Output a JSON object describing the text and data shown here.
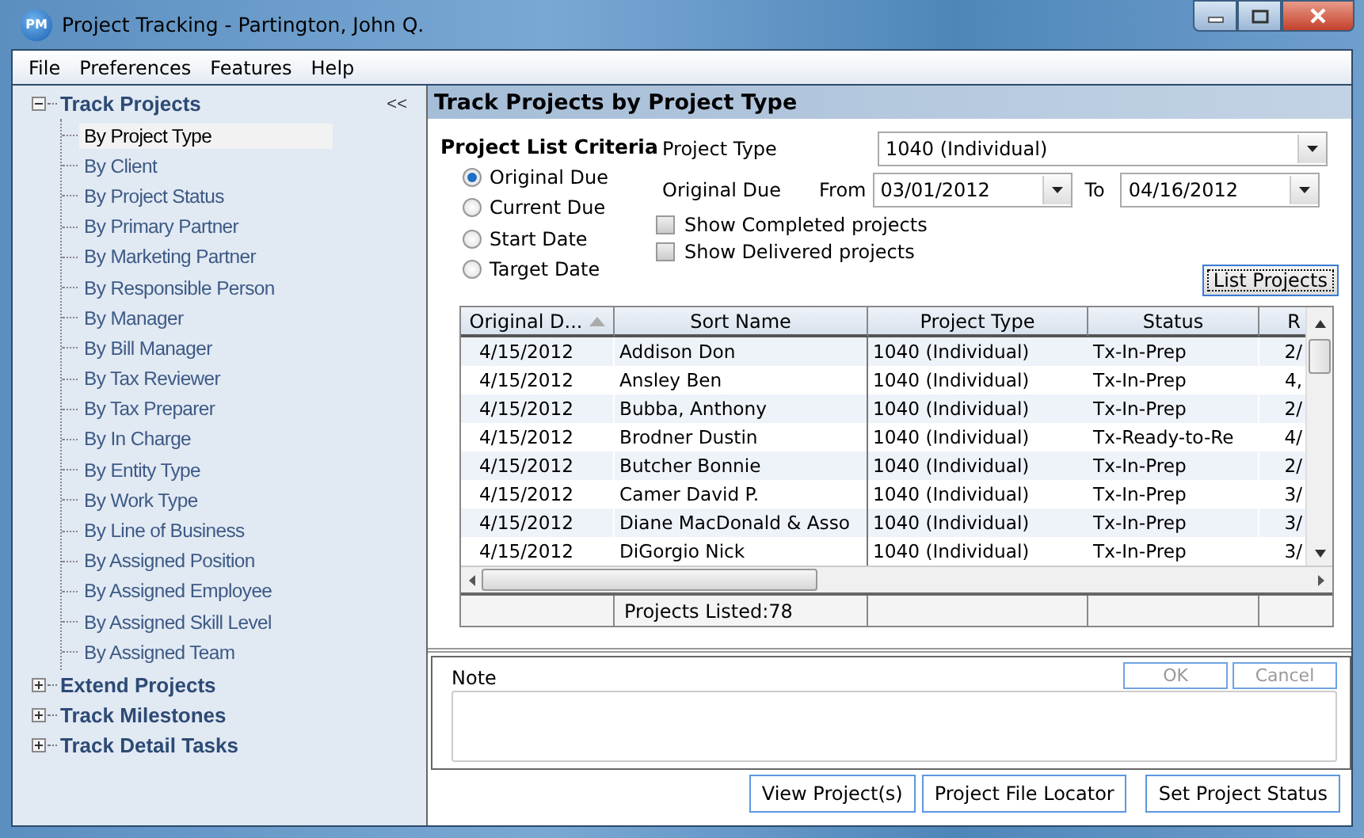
{
  "window": {
    "title": "Project Tracking - Partington, John Q.",
    "app_icon_text": "PM"
  },
  "menu": [
    "File",
    "Preferences",
    "Features",
    "Help"
  ],
  "sidebar": {
    "collapse": "<<",
    "groups": [
      {
        "label": "Track Projects",
        "expanded": true,
        "children": [
          {
            "label": "By Project Type",
            "selected": true
          },
          {
            "label": "By Client",
            "selected": false
          },
          {
            "label": "By Project Status",
            "selected": false
          },
          {
            "label": "By Primary Partner",
            "selected": false
          },
          {
            "label": "By Marketing Partner",
            "selected": false
          },
          {
            "label": "By Responsible Person",
            "selected": false
          },
          {
            "label": "By Manager",
            "selected": false
          },
          {
            "label": "By Bill Manager",
            "selected": false
          },
          {
            "label": "By Tax Reviewer",
            "selected": false
          },
          {
            "label": "By Tax Preparer",
            "selected": false
          },
          {
            "label": "By In Charge",
            "selected": false
          },
          {
            "label": "By Entity Type",
            "selected": false
          },
          {
            "label": "By Work Type",
            "selected": false
          },
          {
            "label": "By Line of Business",
            "selected": false
          },
          {
            "label": "By Assigned Position",
            "selected": false
          },
          {
            "label": "By Assigned Employee",
            "selected": false
          },
          {
            "label": "By Assigned Skill Level",
            "selected": false
          },
          {
            "label": "By Assigned Team",
            "selected": false
          }
        ]
      },
      {
        "label": "Extend Projects",
        "expanded": false
      },
      {
        "label": "Track Milestones",
        "expanded": false
      },
      {
        "label": "Track Detail Tasks",
        "expanded": false
      }
    ]
  },
  "panel": {
    "title": "Track Projects by Project Type",
    "criteria_label": "Project List Criteria",
    "date_options": [
      {
        "label": "Original Due",
        "selected": true
      },
      {
        "label": "Current Due",
        "selected": false
      },
      {
        "label": "Start Date",
        "selected": false
      },
      {
        "label": "Target Date",
        "selected": false
      }
    ],
    "project_type": {
      "label": "Project Type",
      "value": "1040 (Individual)"
    },
    "date_range": {
      "label": "Original Due",
      "from_label": "From",
      "from": "03/01/2012",
      "to_label": "To",
      "to": "04/16/2012"
    },
    "options": [
      {
        "label": "Show Completed projects",
        "checked": false
      },
      {
        "label": "Show Delivered projects",
        "checked": false
      }
    ],
    "list_button": "List Projects"
  },
  "table": {
    "columns": [
      {
        "label": "Original D...",
        "sorted": true
      },
      {
        "label": "Sort Name",
        "sorted": false
      },
      {
        "label": "Project Type",
        "sorted": false
      },
      {
        "label": "Status",
        "sorted": false
      },
      {
        "label": "R",
        "sorted": false
      }
    ],
    "rows": [
      [
        "4/15/2012",
        "Addison Don",
        "1040 (Individual)",
        "Tx-In-Prep",
        "2/"
      ],
      [
        "4/15/2012",
        "Ansley Ben",
        "1040 (Individual)",
        "Tx-In-Prep",
        "4,"
      ],
      [
        "4/15/2012",
        "Bubba, Anthony",
        "1040 (Individual)",
        "Tx-In-Prep",
        "2/"
      ],
      [
        "4/15/2012",
        "Brodner Dustin",
        "1040 (Individual)",
        "Tx-Ready-to-Re",
        "4/"
      ],
      [
        "4/15/2012",
        "Butcher Bonnie",
        "1040 (Individual)",
        "Tx-In-Prep",
        "2/"
      ],
      [
        "4/15/2012",
        "Camer David P.",
        "1040 (Individual)",
        "Tx-In-Prep",
        "3/"
      ],
      [
        "4/15/2012",
        "Diane MacDonald & Asso",
        "1040 (Individual)",
        "Tx-In-Prep",
        "3/"
      ],
      [
        "4/15/2012",
        "DiGorgio Nick",
        "1040 (Individual)",
        "Tx-In-Prep",
        "3/"
      ]
    ],
    "footer": "Projects Listed:78"
  },
  "note": {
    "label": "Note",
    "ok": "OK",
    "cancel": "Cancel"
  },
  "buttons": [
    "View Project(s)",
    "Project File Locator",
    "Set Project Status"
  ]
}
